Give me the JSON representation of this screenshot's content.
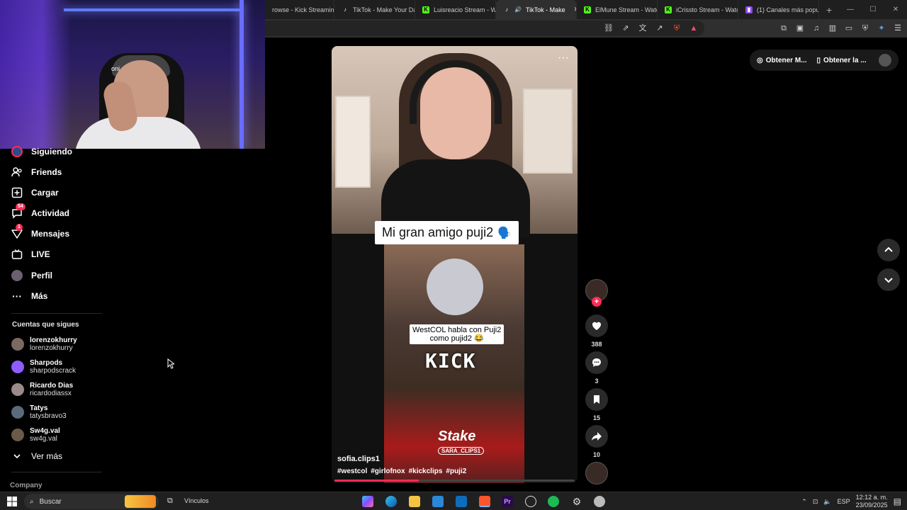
{
  "browser": {
    "tabs": [
      {
        "label": "rowse - Kick Streamin",
        "favicon": "none",
        "active": false
      },
      {
        "label": "TikTok - Make Your Da",
        "favicon": "tiktok-icon",
        "active": false
      },
      {
        "label": "Luisreacio Stream - Wa",
        "favicon": "kick-icon",
        "active": false
      },
      {
        "label": "TikTok - Make",
        "favicon": "tiktok-icon",
        "active": true
      },
      {
        "label": "ElMune Stream - Watc",
        "favicon": "kick-icon",
        "active": false
      },
      {
        "label": "iCrissto Stream - Watc",
        "favicon": "kick-icon",
        "active": false
      },
      {
        "label": "(1) Canales más popu",
        "favicon": "twitch-icon",
        "active": false
      }
    ]
  },
  "webcam": {
    "overlay_text": "oni"
  },
  "sidebar": {
    "items": [
      {
        "label": "Siguiendo",
        "icon": "following-icon"
      },
      {
        "label": "Friends",
        "icon": "friends-icon"
      },
      {
        "label": "Cargar",
        "icon": "upload-icon"
      },
      {
        "label": "Actividad",
        "icon": "activity-icon",
        "badge": "54"
      },
      {
        "label": "Mensajes",
        "icon": "messages-icon",
        "badge": "1"
      },
      {
        "label": "LIVE",
        "icon": "live-icon"
      },
      {
        "label": "Perfil",
        "icon": "profile-avatar"
      },
      {
        "label": "Más",
        "icon": "more-icon"
      }
    ],
    "following_title": "Cuentas que sigues",
    "accounts": [
      {
        "name": "lorenzokhurry",
        "username": "lorenzokhurry"
      },
      {
        "name": "Sharpods",
        "username": "sharpodscrack"
      },
      {
        "name": "Ricardo Dias",
        "username": "ricardodiassx"
      },
      {
        "name": "Tatys",
        "username": "tatysbravo3"
      },
      {
        "name": "Sw4g.val",
        "username": "sw4g.val"
      }
    ],
    "see_more": "Ver más",
    "company": "Company"
  },
  "video": {
    "caption": "Mi gran amigo puji2",
    "caption_emoji": "🗣️",
    "clip_label_line1": "WestCOL habla con Puji2",
    "clip_label_line2": "como pujid2 😂",
    "kick_logo": "KICK",
    "stake_logo": "Stake",
    "stake_sub": "SARA_CLIPS1",
    "author": "sofia.clips1",
    "tags": [
      "#westcol",
      "#girlofnox",
      "#kickclips",
      "#puji2"
    ],
    "progress": 0.35
  },
  "actions": {
    "likes": "388",
    "comments": "3",
    "saves": "15",
    "shares": "10"
  },
  "header_pills": {
    "get_app": "Obtener M...",
    "get_pc": "Obtener la ..."
  },
  "taskbar": {
    "search_placeholder": "Buscar",
    "links": "Vínculos",
    "lang": "ESP",
    "time": "12:12 a. m.",
    "date": "23/09/2025"
  },
  "colors": {
    "accent": "#fe2c55",
    "kick": "#53fc18",
    "twitch": "#9146ff"
  }
}
